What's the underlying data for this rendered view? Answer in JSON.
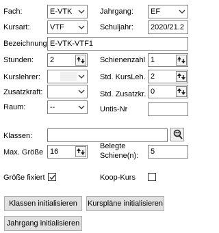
{
  "fach": {
    "label": "Fach:",
    "value": "E-VTK"
  },
  "jahrgang": {
    "label": "Jahrgang:",
    "value": "EF"
  },
  "kursart": {
    "label": "Kursart:",
    "value": "VTF"
  },
  "schuljahr": {
    "label": "Schuljahr:",
    "value": "2020/21.2"
  },
  "bezeichnung": {
    "label": "Bezeichnung:",
    "value": "E-VTK-VTF1"
  },
  "stunden": {
    "label": "Stunden:",
    "value": "2"
  },
  "schienenzahl": {
    "label": "Schienenzahl",
    "value": "1"
  },
  "kurslehrer": {
    "label": "Kurslehrer:",
    "value": ""
  },
  "std_kursleh": {
    "label": "Std. KursLeh.",
    "value": "2"
  },
  "zusatzkraft": {
    "label": "Zusatzkraft:",
    "value": ""
  },
  "std_zusatzkr": {
    "label": "Std. Zusatzkr.",
    "value": "0"
  },
  "raum": {
    "label": "Raum:",
    "value": "--"
  },
  "untis_nr": {
    "label": "Untis-Nr",
    "value": ""
  },
  "klassen": {
    "label": "Klassen:",
    "value": ""
  },
  "max_groesse": {
    "label": "Max. Größe",
    "value": "16"
  },
  "belegte_schiene": {
    "label_line1": "Belegte",
    "label_line2": "Schiene(n):",
    "value": "5"
  },
  "groesse_fixiert": {
    "label": "Größe fixiert",
    "checked": true
  },
  "koop_kurs": {
    "label": "Koop-Kurs",
    "checked": false
  },
  "buttons": {
    "klassen_init": "Klassen initialisieren",
    "kursplaene_init": "Kurspläne initialisieren",
    "jahrgang_init": "Jahrgang initialisieren"
  },
  "icons": {
    "chevron": "chevron-down-icon",
    "spinner": "spin-arrows-icon",
    "search": "search-people-icon",
    "check": "checkmark-icon"
  }
}
